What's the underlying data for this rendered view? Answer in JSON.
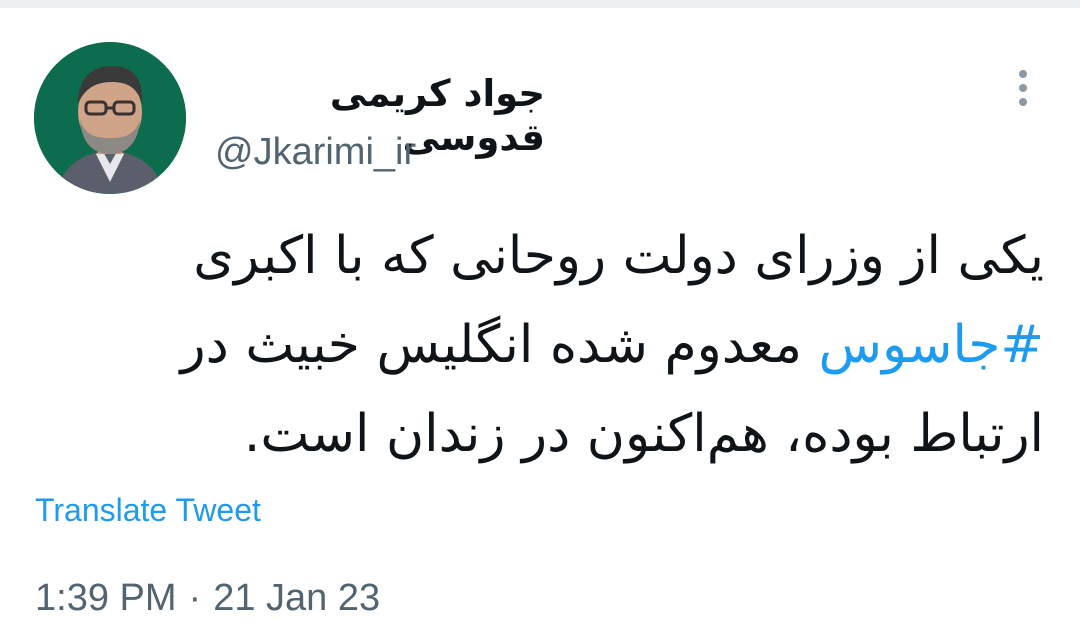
{
  "tweet": {
    "author": {
      "display_name": "جواد کریمی قدوسی",
      "handle": "@Jkarimi_ir"
    },
    "text": {
      "lines": [
        "یکی از وزرای دولت روحانی که با اکبری",
        "معدوم شده انگلیس خبیث در",
        "ارتباط بوده، هم‌اکنون در زندان است."
      ],
      "hashtag": "#جاسوس"
    },
    "translate_label": "Translate Tweet",
    "time": "1:39 PM",
    "separator": "·",
    "date": "21 Jan 23",
    "more_icon": "more-vertical-icon"
  },
  "colors": {
    "link": "#1d9bf0",
    "secondary_text": "#536471",
    "primary_text": "#0f1419",
    "avatar_background": "#0d6b4e"
  }
}
